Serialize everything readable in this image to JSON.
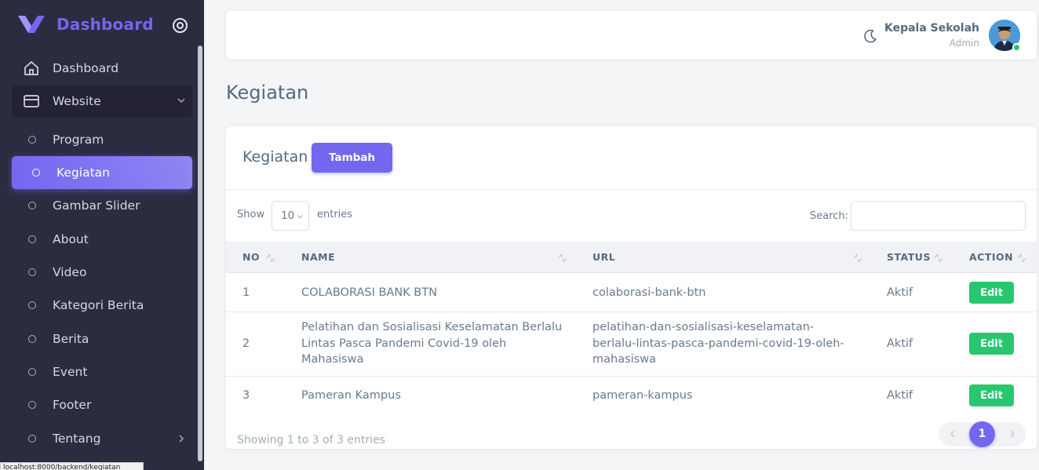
{
  "brand": {
    "name": "Dashboard"
  },
  "sidebar": {
    "items": [
      {
        "label": "Dashboard",
        "icon": "home-icon"
      },
      {
        "label": "Website",
        "icon": "browser-icon",
        "expanded": true
      }
    ],
    "submenu": [
      {
        "label": "Program"
      },
      {
        "label": "Kegiatan",
        "active": true
      },
      {
        "label": "Gambar Slider"
      },
      {
        "label": "About"
      },
      {
        "label": "Video"
      },
      {
        "label": "Kategori Berita"
      },
      {
        "label": "Berita"
      },
      {
        "label": "Event"
      },
      {
        "label": "Footer"
      },
      {
        "label": "Tentang",
        "has_children": true
      }
    ]
  },
  "status_bar": {
    "url": "localhost:8000/backend/kegiatan"
  },
  "navbar": {
    "user_name": "Kepala Sekolah",
    "user_role": "Admin",
    "theme_icon": "moon-icon"
  },
  "page": {
    "title": "Kegiatan"
  },
  "card": {
    "title": "Kegiatan",
    "add_button": "Tambah",
    "show_label": "Show",
    "page_length": "10",
    "entries_label": "entries",
    "search_label": "Search:",
    "search_value": "",
    "columns": [
      "NO",
      "NAME",
      "URL",
      "STATUS",
      "ACTION"
    ],
    "rows": [
      {
        "no": "1",
        "name": "COLABORASI BANK BTN",
        "url": "colaborasi-bank-btn",
        "status": "Aktif",
        "action": "Edit"
      },
      {
        "no": "2",
        "name": "Pelatihan dan Sosialisasi Keselamatan Berlalu Lintas Pasca Pandemi Covid-19 oleh Mahasiswa",
        "url": "pelatihan-dan-sosialisasi-keselamatan-berlalu-lintas-pasca-pandemi-covid-19-oleh-mahasiswa",
        "status": "Aktif",
        "action": "Edit"
      },
      {
        "no": "3",
        "name": "Pameran Kampus",
        "url": "pameran-kampus",
        "status": "Aktif",
        "action": "Edit"
      }
    ],
    "info": "Showing 1 to 3 of 3 entries",
    "current_page": "1"
  },
  "colors": {
    "primary": "#7367f0",
    "success": "#28c76f",
    "sidebar_bg": "#2b2c40",
    "body_bg": "#f4f5f7"
  }
}
